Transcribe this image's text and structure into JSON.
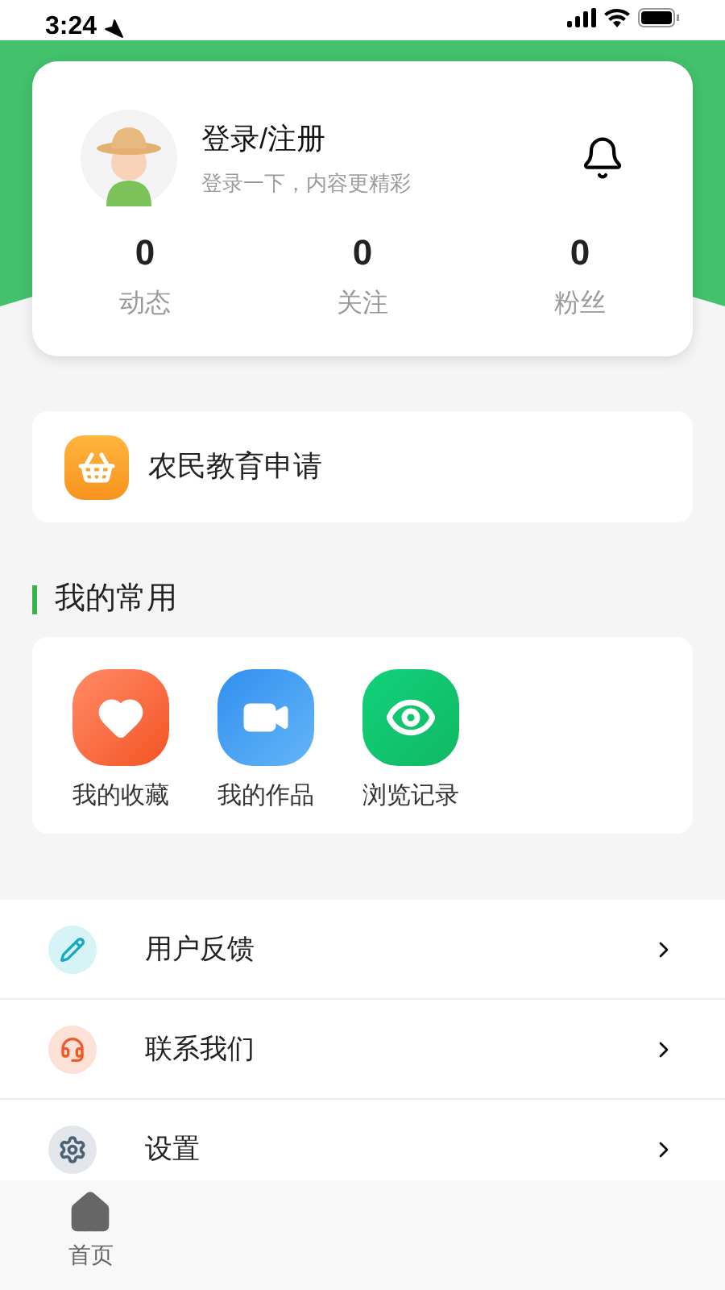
{
  "status_bar": {
    "time": "3:24"
  },
  "profile": {
    "title": "登录/注册",
    "subtitle": "登录一下，内容更精彩",
    "stats": [
      {
        "value": "0",
        "label": "动态"
      },
      {
        "value": "0",
        "label": "关注"
      },
      {
        "value": "0",
        "label": "粉丝"
      }
    ]
  },
  "banner": {
    "label": "农民教育申请"
  },
  "section": {
    "title": "我的常用"
  },
  "shortcuts": [
    {
      "kind": "favorites",
      "label": "我的收藏"
    },
    {
      "kind": "works",
      "label": "我的作品"
    },
    {
      "kind": "history",
      "label": "浏览记录"
    }
  ],
  "menu": [
    {
      "kind": "feedback",
      "label": "用户反馈"
    },
    {
      "kind": "contact",
      "label": "联系我们"
    },
    {
      "kind": "settings",
      "label": "设置"
    }
  ],
  "tab_bar": [
    {
      "label": "首页"
    }
  ]
}
